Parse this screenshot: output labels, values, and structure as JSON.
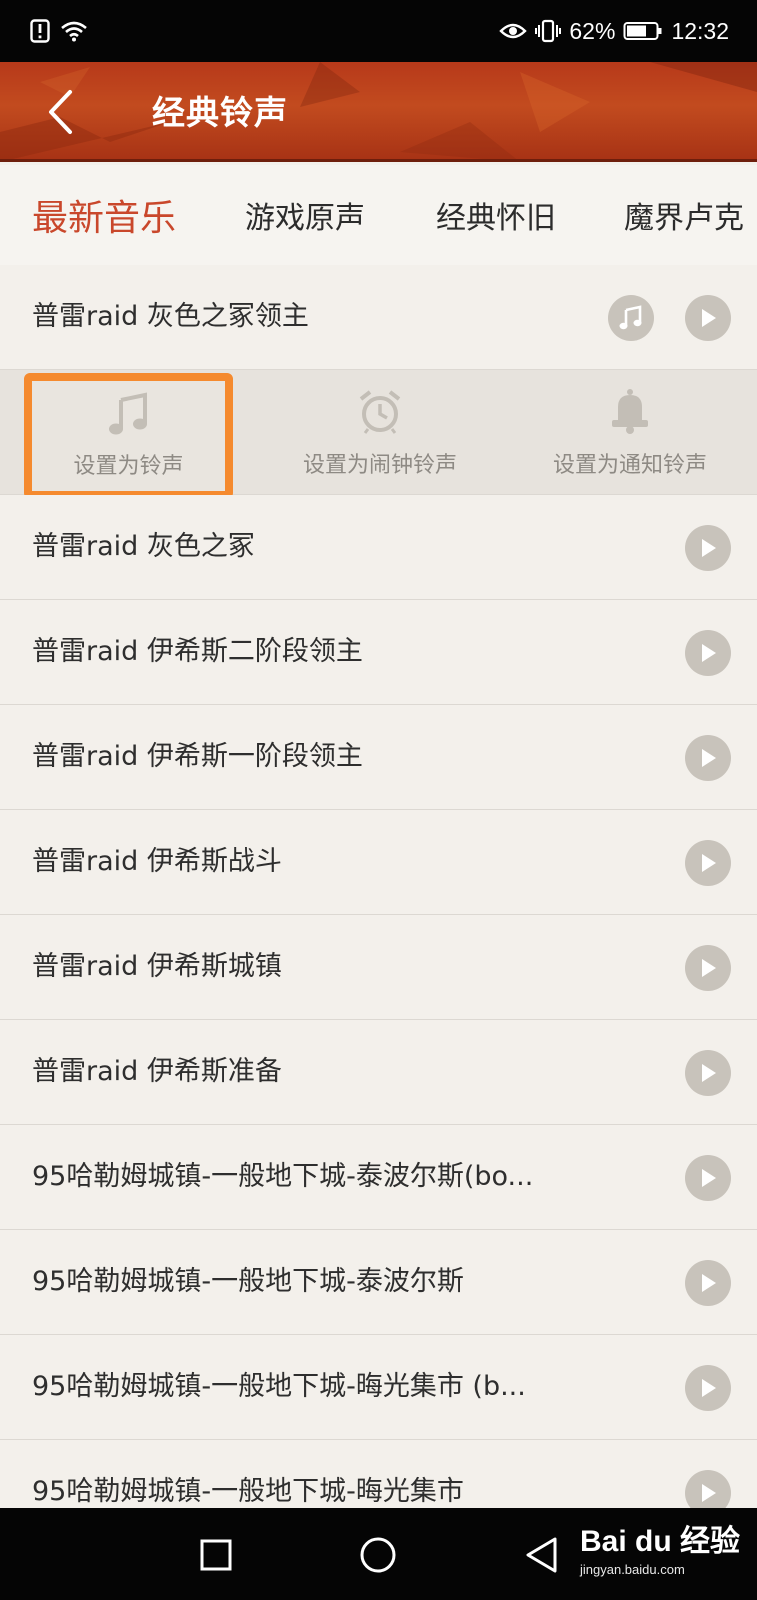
{
  "status_bar": {
    "battery": "62%",
    "time": "12:32"
  },
  "header": {
    "title": "经典铃声"
  },
  "tabs": [
    {
      "label": "最新音乐",
      "active": true
    },
    {
      "label": "游戏原声",
      "active": false
    },
    {
      "label": "经典怀旧",
      "active": false
    },
    {
      "label": "魔界卢克",
      "active": false
    }
  ],
  "list": {
    "expanded_item": {
      "title": "普雷raid 灰色之冢领主",
      "actions": [
        {
          "label": "设置为铃声",
          "icon": "music-note-icon",
          "highlighted": true
        },
        {
          "label": "设置为闹钟铃声",
          "icon": "alarm-clock-icon",
          "highlighted": false
        },
        {
          "label": "设置为通知铃声",
          "icon": "bell-icon",
          "highlighted": false
        }
      ]
    },
    "items": [
      "普雷raid 灰色之冢",
      "普雷raid 伊希斯二阶段领主",
      "普雷raid 伊希斯一阶段领主",
      "普雷raid 伊希斯战斗",
      "普雷raid 伊希斯城镇",
      "普雷raid 伊希斯准备",
      "95哈勒姆城镇-一般地下城-泰波尔斯(bo...",
      "95哈勒姆城镇-一般地下城-泰波尔斯",
      "95哈勒姆城镇-一般地下城-晦光集市 (b...",
      "95哈勒姆城镇-一般地下城-晦光集市"
    ]
  },
  "watermark": {
    "logo": "Bai du 经验",
    "url": "jingyan.baidu.com"
  },
  "colors": {
    "accent": "#c9472b",
    "header": "#b7391a",
    "highlight_border": "#f58a2e",
    "button_grey": "#c8c3bb"
  }
}
